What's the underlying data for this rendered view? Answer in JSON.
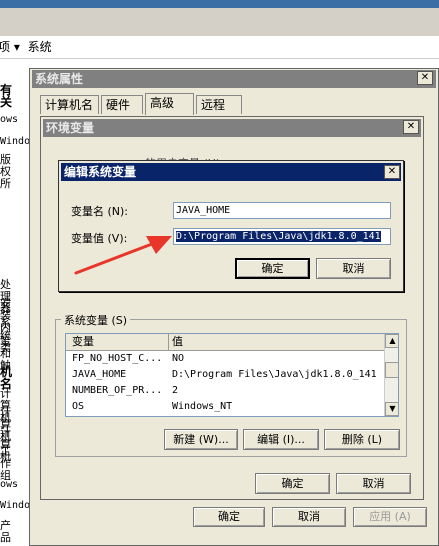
{
  "breadcrumb": {
    "left": "项 ▾",
    "item": "系统"
  },
  "background_fragments": [
    "有关",
    "ows",
    "Windo",
    "版权所",
    "处理器",
    "安装内",
    "系统类",
    "笔和触",
    "机名",
    "计算机",
    "计算机",
    "计算机",
    "工作组",
    "ows",
    "Windo",
    "产品"
  ],
  "sys_props": {
    "title": "系统属性",
    "tabs": [
      "计算机名",
      "硬件",
      "高级",
      "远程"
    ],
    "ok": "确定",
    "cancel": "取消",
    "apply": "应用 (A)"
  },
  "env_vars": {
    "title": "环境变量",
    "user_section_partial": "的用户变量 (U)",
    "sys_section": "系统变量 (S)",
    "columns": [
      "变量",
      "值"
    ],
    "rows": [
      {
        "name": "FP_NO_HOST_C...",
        "value": "NO"
      },
      {
        "name": "JAVA_HOME",
        "value": "D:\\Program Files\\Java\\jdk1.8.0_141"
      },
      {
        "name": "NUMBER_OF_PR...",
        "value": "2"
      },
      {
        "name": "OS",
        "value": "Windows_NT"
      }
    ],
    "new_btn": "新建 (W)...",
    "edit_btn": "编辑 (I)...",
    "delete_btn": "删除 (L)",
    "ok": "确定",
    "cancel": "取消"
  },
  "edit_dialog": {
    "title": "编辑系统变量",
    "name_label": "变量名 (N):",
    "value_label": "变量值 (V):",
    "name_value": "JAVA_HOME",
    "value_value": "D:\\Program Files\\Java\\jdk1.8.0_141",
    "ok": "确定",
    "cancel": "取消"
  },
  "colors": {
    "title_active": "#0a246a",
    "title_inactive": "#808080",
    "dialog_bg": "#ece9d8",
    "selection": "#0a246a",
    "arrow": "#e8362b"
  }
}
